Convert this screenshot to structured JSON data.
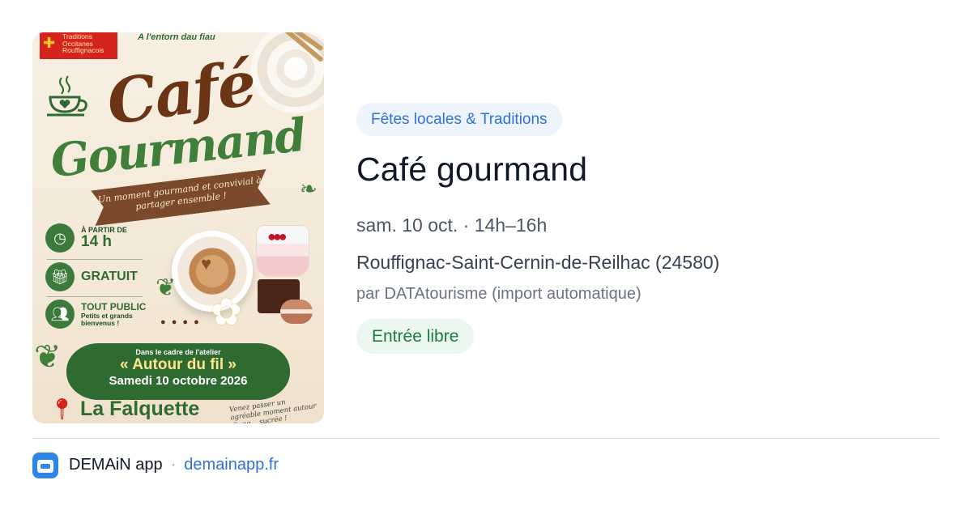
{
  "poster": {
    "logo_lines": [
      "Traditions",
      "Occitanes",
      "Rouffignacois"
    ],
    "top_line": "A l'entorn dau fiau",
    "title_1": "Café",
    "title_2": "Gourmand",
    "ribbon": "Un moment gourmand et convivial à partager ensemble !",
    "time_small": "À PARTIR DE",
    "time_big": "14 h",
    "price": "GRATUIT",
    "audience_title": "TOUT PUBLIC",
    "audience_sub": "Petits et grands bienvenus !",
    "banner_line1": "Dans le cadre de l'atelier",
    "banner_line2": "« Autour du fil »",
    "banner_line3": "Samedi 10 octobre 2026",
    "place": "La Falquette",
    "note": "Venez passer un agréable moment autour d'une ...sucrée !"
  },
  "event": {
    "category": "Fêtes locales & Traditions",
    "title": "Café gourmand",
    "datetime": "sam. 10 oct. · 14h–16h",
    "location": "Rouffignac-Saint-Cernin-de-Reilhac (24580)",
    "source": "par DATAtourisme (import automatique)",
    "price_badge": "Entrée libre"
  },
  "footer": {
    "app_name": "DEMAiN app",
    "separator": "·",
    "domain": "demainapp.fr"
  },
  "colors": {
    "chip_bg": "#eef4fc",
    "chip_text": "#2f71d6",
    "badge_bg": "#ecf8ef",
    "badge_text": "#1f7a3d",
    "accent": "#2e86e6"
  }
}
